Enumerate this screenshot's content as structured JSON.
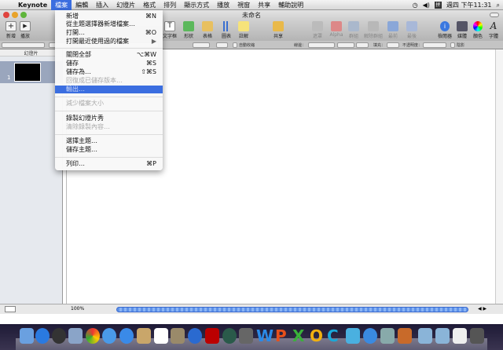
{
  "menubar": {
    "app": "Keynote",
    "items": [
      "檔案",
      "編輯",
      "插入",
      "幻燈片",
      "格式",
      "排列",
      "顯示方式",
      "播放",
      "視窗",
      "共享",
      "輔助說明"
    ],
    "clock": "週四 下午11:31"
  },
  "window": {
    "title": "未命名"
  },
  "toolbar": {
    "new": "新增",
    "play": "播放",
    "textbox": "文字框",
    "shapes": "形狀",
    "table": "表格",
    "chart": "圖表",
    "comment": "註解",
    "share": "共享",
    "mask": "遮罩",
    "alpha": "Alpha",
    "group": "群組",
    "ungroup": "解除群組",
    "front": "最前",
    "back": "最後",
    "inspector": "檢閱器",
    "media": "媒體",
    "colors": "顏色",
    "fonts": "字體"
  },
  "formatbar": {
    "autoshrink": "自動收縮",
    "stroke": "線邊：",
    "fill": "填充：",
    "opacity": "不透明度：",
    "shadow": "陰影"
  },
  "sidebar": {
    "header": "幻燈片",
    "slide_number": "1"
  },
  "bottombar": {
    "zoom": "100%"
  },
  "file_menu": [
    {
      "label": "新增",
      "shortcut": "⌘N"
    },
    {
      "label": "從主題選擇器新增檔案…",
      "shortcut": ""
    },
    {
      "label": "打開…",
      "shortcut": "⌘O"
    },
    {
      "label": "打開最近使用過的檔案",
      "shortcut": "▶"
    },
    {
      "label": "關閉全部",
      "shortcut": "⌥⌘W"
    },
    {
      "label": "儲存",
      "shortcut": "⌘S"
    },
    {
      "label": "儲存為…",
      "shortcut": "⇧⌘S"
    },
    {
      "label": "回復成已儲存版本…",
      "shortcut": ""
    },
    {
      "label": "輸出…",
      "shortcut": ""
    },
    {
      "label": "減少檔案大小",
      "shortcut": ""
    },
    {
      "label": "錄製幻燈片秀",
      "shortcut": ""
    },
    {
      "label": "清除錄製內容…",
      "shortcut": ""
    },
    {
      "label": "選擇主題…",
      "shortcut": ""
    },
    {
      "label": "儲存主題…",
      "shortcut": ""
    },
    {
      "label": "列印…",
      "shortcut": "⌘P"
    }
  ],
  "dock": {
    "letters": [
      "W",
      "P",
      "X",
      "O",
      "C"
    ]
  }
}
